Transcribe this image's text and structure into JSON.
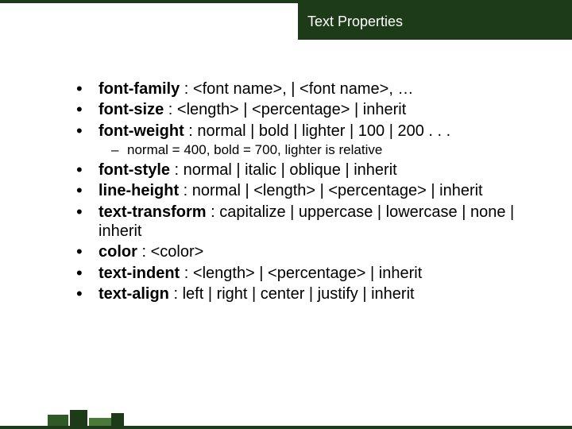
{
  "title": "Text Properties",
  "items": [
    {
      "prop": "font-family",
      "desc": " : <font name>, | <font name>, …"
    },
    {
      "prop": "font-size",
      "desc": " : <length> | <percentage> | inherit"
    },
    {
      "prop": "font-weight",
      "desc": " : normal | bold | lighter | 100 | 200 . . .",
      "sub": [
        "normal = 400, bold = 700, lighter is relative"
      ]
    },
    {
      "prop": "font-style",
      "desc": " : normal | italic | oblique | inherit"
    },
    {
      "prop": "line-height",
      "desc": " : normal | <length> | <percentage> | inherit"
    },
    {
      "prop": "text-transform",
      "desc": " : capitalize | uppercase | lowercase | none | inherit"
    },
    {
      "prop": "color",
      "desc": " : <color>"
    },
    {
      "prop": "text-indent",
      "desc": " : <length> | <percentage> | inherit"
    },
    {
      "prop": "text-align",
      "desc": " : left | right | center | justify | inherit"
    }
  ]
}
